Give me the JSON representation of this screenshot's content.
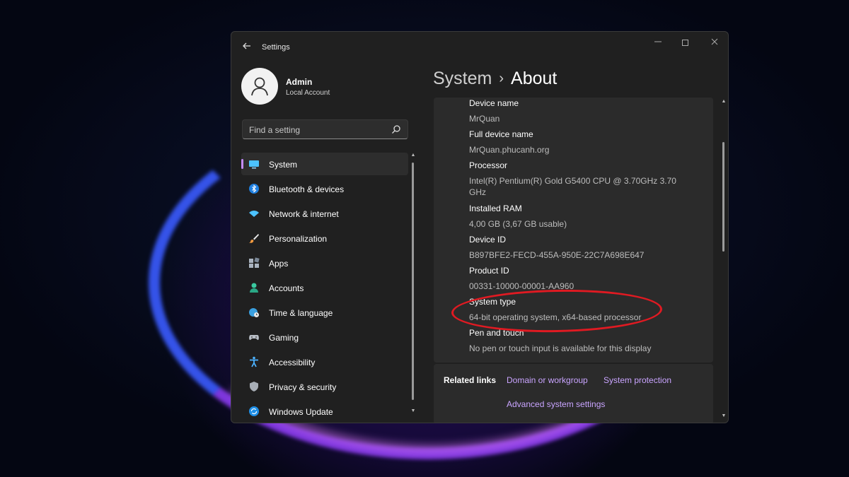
{
  "window": {
    "app_title": "Settings",
    "back_icon": "arrow-left-icon",
    "controls": [
      "minimize-icon",
      "maximize-icon",
      "close-icon"
    ]
  },
  "profile": {
    "name": "Admin",
    "account_type": "Local Account"
  },
  "search": {
    "placeholder": "Find a setting"
  },
  "sidebar": {
    "items": [
      {
        "label": "System",
        "icon": "monitor-icon",
        "selected": true
      },
      {
        "label": "Bluetooth & devices",
        "icon": "bluetooth-icon"
      },
      {
        "label": "Network & internet",
        "icon": "wifi-icon"
      },
      {
        "label": "Personalization",
        "icon": "brush-icon"
      },
      {
        "label": "Apps",
        "icon": "apps-icon"
      },
      {
        "label": "Accounts",
        "icon": "person-icon"
      },
      {
        "label": "Time & language",
        "icon": "globe-clock-icon"
      },
      {
        "label": "Gaming",
        "icon": "gamepad-icon"
      },
      {
        "label": "Accessibility",
        "icon": "accessibility-icon"
      },
      {
        "label": "Privacy & security",
        "icon": "shield-icon"
      },
      {
        "label": "Windows Update",
        "icon": "update-icon"
      }
    ]
  },
  "breadcrumb": {
    "parent": "System",
    "separator": "›",
    "current": "About"
  },
  "specs": [
    {
      "label": "Device name",
      "value": "MrQuan"
    },
    {
      "label": "Full device name",
      "value": "MrQuan.phucanh.org"
    },
    {
      "label": "Processor",
      "value": "Intel(R) Pentium(R) Gold G5400 CPU @ 3.70GHz   3.70 GHz"
    },
    {
      "label": "Installed RAM",
      "value": "4,00 GB (3,67 GB usable)"
    },
    {
      "label": "Device ID",
      "value": "B897BFE2-FECD-455A-950E-22C7A698E647"
    },
    {
      "label": "Product ID",
      "value": "00331-10000-00001-AA960"
    },
    {
      "label": "System type",
      "value": "64-bit operating system, x64-based processor"
    },
    {
      "label": "Pen and touch",
      "value": "No pen or touch input is available for this display"
    }
  ],
  "related_links": {
    "title": "Related links",
    "links": [
      "Domain or workgroup",
      "System protection",
      "Advanced system settings"
    ]
  },
  "colors": {
    "accent": "#c48cff",
    "link": "#c9a4ff",
    "annotation": "#e01a22",
    "window_bg": "#202020",
    "card_bg": "#2b2b2b"
  }
}
